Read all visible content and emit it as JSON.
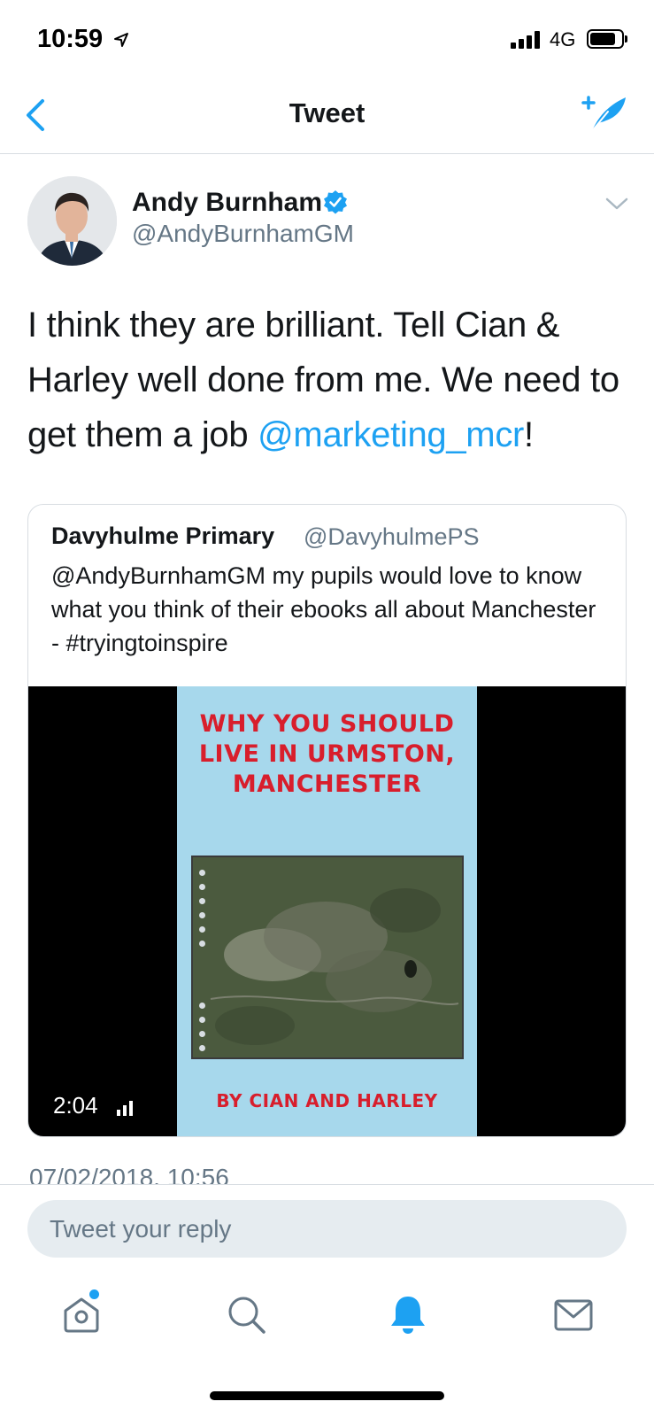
{
  "status_bar": {
    "time": "10:59",
    "network": "4G",
    "location_icon": "location-arrow-icon",
    "signal_icon": "signal-bars-icon",
    "battery_icon": "battery-icon"
  },
  "nav": {
    "title": "Tweet",
    "back_icon": "chevron-left-icon",
    "compose_icon": "compose-tweet-icon"
  },
  "tweet": {
    "author_name": "Andy Burnham",
    "author_handle": "@AndyBurnhamGM",
    "verified": true,
    "text_before": "I think they are brilliant. Tell Cian & Harley well done from me. We need to get them a job ",
    "mention": "@marketing_mcr",
    "text_after": "!",
    "timestamp": "07/02/2018, 10:56"
  },
  "quoted_tweet": {
    "author_name": "Davyhulme Primary",
    "author_handle": "@DavyhulmePS",
    "text": "@AndyBurnhamGM my pupils would love to know what you think of their ebooks all about Manchester - #tryingtoinspire",
    "video": {
      "duration": "2:04",
      "cover_title": "Why you should live in Urmston, Manchester",
      "cover_byline": "By Cian and Harley"
    }
  },
  "reply": {
    "placeholder": "Tweet your reply"
  },
  "tabbar": {
    "items": [
      "home-icon",
      "search-icon",
      "notifications-icon",
      "messages-icon"
    ],
    "active": "notifications-icon"
  },
  "colors": {
    "accent": "#1da1f2",
    "text_primary": "#14171a",
    "text_secondary": "#657786",
    "border": "#d8dde2",
    "cover_background": "#a7d8ec",
    "cover_title": "#d81e2c"
  }
}
